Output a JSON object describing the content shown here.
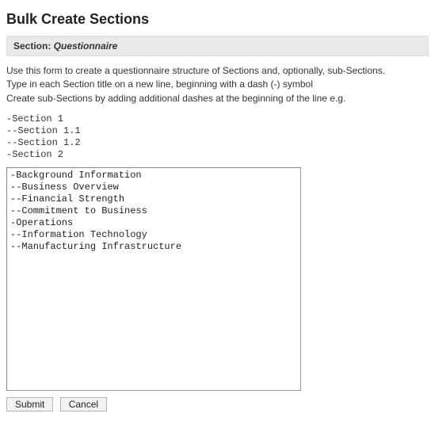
{
  "page_title": "Bulk Create Sections",
  "section": {
    "label": "Section: ",
    "name": "Questionnaire"
  },
  "instructions": {
    "line1": "Use this form to create a questionnaire structure of Sections and, optionally, sub-Sections.",
    "line2": "Type in each Section title on a new line, beginning with a dash (-) symbol",
    "line3": "Create sub-Sections by adding additional dashes at the beginning of the line e.g."
  },
  "example": "-Section 1\n--Section 1.1\n--Section 1.2\n-Section 2",
  "textarea_value": "-Background Information\n--Business Overview\n--Financial Strength\n--Commitment to Business\n-Operations\n--Information Technology\n--Manufacturing Infrastructure",
  "buttons": {
    "submit": "Submit",
    "cancel": "Cancel"
  }
}
